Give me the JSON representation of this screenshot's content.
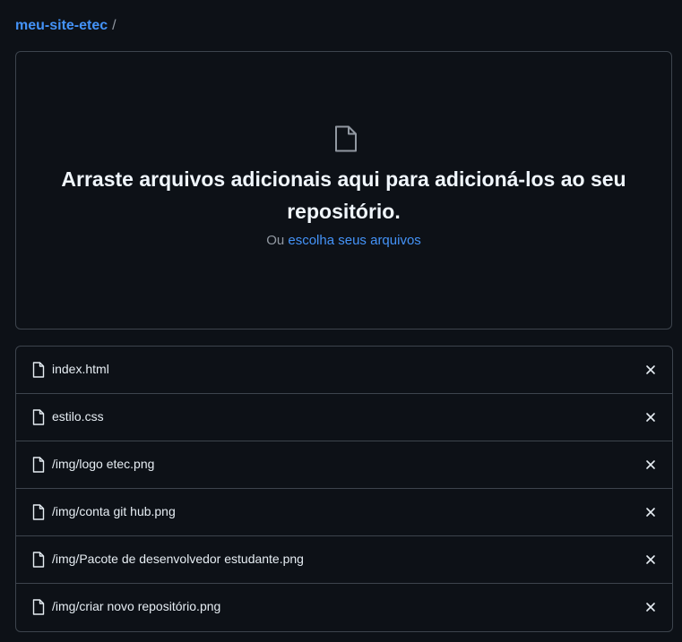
{
  "breadcrumb": {
    "repo": "meu-site-etec",
    "separator": "/"
  },
  "dropzone": {
    "icon": "file-icon",
    "title": "Arraste arquivos adicionais aqui para adicioná-los ao seu repositório.",
    "subtitle_prefix": "Ou",
    "subtitle_link": "escolha seus arquivos"
  },
  "files": [
    {
      "name": "index.html",
      "icon": "file-icon",
      "action": "close-icon"
    },
    {
      "name": "estilo.css",
      "icon": "file-icon",
      "action": "close-icon"
    },
    {
      "name": "/img/logo etec.png",
      "icon": "file-icon",
      "action": "close-icon"
    },
    {
      "name": "/img/conta git hub.png",
      "icon": "file-icon",
      "action": "close-icon"
    },
    {
      "name": "/img/Pacote de desenvolvedor estudante.png",
      "icon": "file-icon",
      "action": "close-icon"
    },
    {
      "name": "/img/criar novo repositório.png",
      "icon": "file-icon",
      "action": "close-icon"
    }
  ],
  "colors": {
    "background": "#0d1117",
    "border": "#3d444d",
    "link": "#4493f8",
    "text": "#e6edf3",
    "muted": "#9198a1"
  }
}
